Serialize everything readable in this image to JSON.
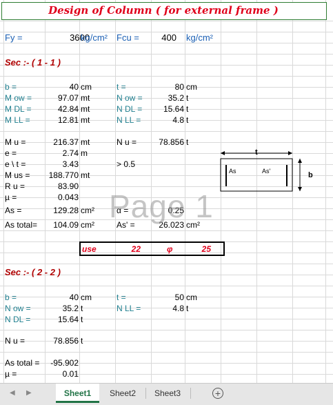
{
  "title": "Design of Column ( for external frame )",
  "watermark": "Page 1",
  "header": {
    "fy_label": "Fy =",
    "fy_value": "3600",
    "fy_unit": "kg/cm²",
    "fcu_label": "Fcu =",
    "fcu_value": "400",
    "fcu_unit": "kg/cm²"
  },
  "sec1": {
    "heading": "Sec :- ( 1 - 1 )",
    "b_label": "b  =",
    "b_value": "40",
    "b_unit": "cm",
    "t_label": "t  =",
    "t_value": "80",
    "t_unit": "cm",
    "mow_label": "M ow =",
    "mow_value": "97.07",
    "mow_unit": "mt",
    "now_label": "N ow =",
    "now_value": "35.2",
    "now_unit": "t",
    "mdl_label": "M DL =",
    "mdl_value": "42.84",
    "mdl_unit": "mt",
    "ndl_label": "N DL =",
    "ndl_value": "15.64",
    "ndl_unit": "t",
    "mll_label": "M LL =",
    "mll_value": "12.81",
    "mll_unit": "mt",
    "nll_label": "N LL =",
    "nll_value": "4.8",
    "nll_unit": "t",
    "mu_label": "M u =",
    "mu_value": "216.37",
    "mu_unit": "mt",
    "nu_label": "N u =",
    "nu_value": "78.856",
    "nu_unit": "t",
    "e_label": "e  =",
    "e_value": "2.74",
    "e_unit": "m",
    "et_label": "e \\ t =",
    "et_value": "3.43",
    "et_cmp": "> 0.5",
    "mus_label": "M us =",
    "mus_value": "188.770",
    "mus_unit": "mt",
    "ru_label": "R u =",
    "ru_value": "83.90",
    "mu2_label": "µ =",
    "mu2_value": "0.043",
    "as_label": "As =",
    "as_value": "129.28",
    "as_unit": "cm²",
    "alpha_label": "α =",
    "alpha_value": "0.25",
    "astot_label": "As total=",
    "astot_value": "104.09",
    "astot_unit": "cm²",
    "asp_label": "As' =",
    "asp_value": "26.023",
    "asp_unit": "cm²",
    "use_word": "use",
    "use_n": "22",
    "use_phi": "φ",
    "use_d": "25"
  },
  "diagram": {
    "t_label": "t",
    "b_label": "b",
    "as_label": "As",
    "asp_label": "As'"
  },
  "sec2": {
    "heading": "Sec :- ( 2 - 2 )",
    "b_label": "b  =",
    "b_value": "40",
    "b_unit": "cm",
    "t_label": "t  =",
    "t_value": "50",
    "t_unit": "cm",
    "now_label": "N ow =",
    "now_value": "35.2",
    "now_unit": "t",
    "nll_label": "N LL =",
    "nll_value": "4.8",
    "nll_unit": "t",
    "ndl_label": "N DL =",
    "ndl_value": "15.64",
    "ndl_unit": "t",
    "nu_label": "N u =",
    "nu_value": "78.856",
    "nu_unit": "t",
    "astot_label": "As total =",
    "astot_value": "-95.902",
    "mu2_label": "µ =",
    "mu2_value": "0.01"
  },
  "tabs": [
    "Sheet1",
    "Sheet2",
    "Sheet3"
  ],
  "colors": {
    "title_red": "#e0001b",
    "teal": "#1f7f8f",
    "tab_green": "#217346"
  }
}
